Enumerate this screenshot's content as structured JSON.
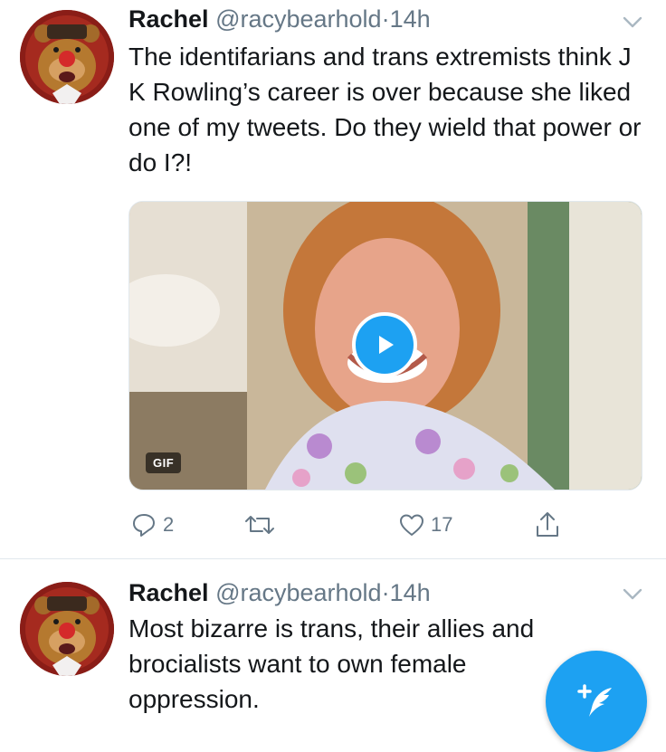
{
  "tweets": [
    {
      "name": "Rachel",
      "handle": "@racybearhold",
      "time": "14h",
      "separator": "·",
      "text": "The identifarians and trans extremists think J K Rowling’s career is over because she liked one of my tweets. Do they wield that power or do I?!",
      "media": {
        "type": "gif",
        "badge": "GIF",
        "play_icon": "play-icon"
      },
      "actions": {
        "replies": "2",
        "retweets": "",
        "likes": "17"
      }
    },
    {
      "name": "Rachel",
      "handle": "@racybearhold",
      "time": "14h",
      "separator": "·",
      "text": "Most bizarre is trans, their allies and brocialists want to own female oppression."
    }
  ],
  "icons": {
    "reply": "reply-icon",
    "retweet": "retweet-icon",
    "like": "heart-icon",
    "share": "share-icon",
    "compose": "compose-tweet-icon",
    "caret": "chevron-down-icon"
  },
  "colors": {
    "accent": "#1da1f2",
    "secondary_text": "#657786",
    "divider": "#e1e8ed"
  }
}
